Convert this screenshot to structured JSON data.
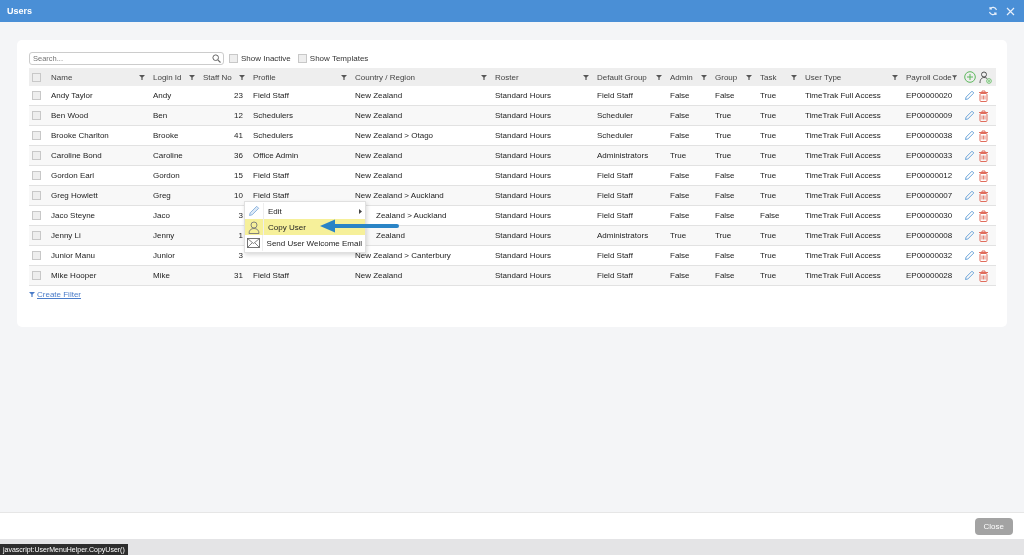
{
  "window": {
    "title": "Users"
  },
  "search": {
    "placeholder": "Search..."
  },
  "toggles": [
    {
      "label": "Show Inactive",
      "checked": false
    },
    {
      "label": "Show Templates",
      "checked": false
    }
  ],
  "table": {
    "select_all_checked": false,
    "columns": [
      "Name",
      "Login Id",
      "Staff No",
      "Profile",
      "Country / Region",
      "Roster",
      "Default Group",
      "Admin",
      "Group",
      "Task",
      "User Type",
      "Payroll Code"
    ],
    "rows": [
      {
        "checked": false,
        "cells": [
          "Andy Taylor",
          "Andy",
          "23",
          "Field Staff",
          "New Zealand",
          "Standard Hours",
          "Field Staff",
          "False",
          "False",
          "True",
          "TimeTrak Full Access",
          "EP00000020"
        ]
      },
      {
        "checked": false,
        "cells": [
          "Ben Wood",
          "Ben",
          "12",
          "Schedulers",
          "New Zealand",
          "Standard Hours",
          "Scheduler",
          "False",
          "True",
          "True",
          "TimeTrak Full Access",
          "EP00000009"
        ]
      },
      {
        "checked": false,
        "cells": [
          "Brooke Charlton",
          "Brooke",
          "41",
          "Schedulers",
          "New Zealand > Otago",
          "Standard Hours",
          "Scheduler",
          "False",
          "True",
          "True",
          "TimeTrak Full Access",
          "EP00000038"
        ]
      },
      {
        "checked": false,
        "cells": [
          "Caroline Bond",
          "Caroline",
          "36",
          "Office Admin",
          "New Zealand",
          "Standard Hours",
          "Administrators",
          "True",
          "True",
          "True",
          "TimeTrak Full Access",
          "EP00000033"
        ]
      },
      {
        "checked": false,
        "cells": [
          "Gordon Earl",
          "Gordon",
          "15",
          "Field Staff",
          "New Zealand",
          "Standard Hours",
          "Field Staff",
          "False",
          "False",
          "True",
          "TimeTrak Full Access",
          "EP00000012"
        ]
      },
      {
        "checked": false,
        "cells": [
          "Greg Howlett",
          "Greg",
          "10",
          "Field Staff",
          "New Zealand > Auckland",
          "Standard Hours",
          "Field Staff",
          "False",
          "False",
          "True",
          "TimeTrak Full Access",
          "EP00000007"
        ]
      },
      {
        "checked": false,
        "covered": true,
        "cells": [
          "Jaco Steyne",
          "Jaco",
          "3",
          null,
          "Zealand > Auckland",
          "Standard Hours",
          "Field Staff",
          "False",
          "False",
          "False",
          "TimeTrak Full Access",
          "EP00000030"
        ]
      },
      {
        "checked": false,
        "covered": true,
        "cells": [
          "Jenny Li",
          "Jenny",
          "1",
          null,
          "Zealand",
          "Standard Hours",
          "Administrators",
          "True",
          "True",
          "True",
          "TimeTrak Full Access",
          "EP00000008"
        ]
      },
      {
        "checked": false,
        "cells": [
          "Junior Manu",
          "Junior",
          "3",
          null,
          "New Zealand > Canterbury",
          "Standard Hours",
          "Field Staff",
          "False",
          "False",
          "True",
          "TimeTrak Full Access",
          "EP00000032"
        ]
      },
      {
        "checked": false,
        "cells": [
          "Mike Hooper",
          "Mike",
          "31",
          "Field Staff",
          "New Zealand",
          "Standard Hours",
          "Field Staff",
          "False",
          "False",
          "True",
          "TimeTrak Full Access",
          "EP00000028"
        ]
      }
    ]
  },
  "create_filter": "Create Filter",
  "context_menu": [
    {
      "kind": "pencil",
      "label": "Edit",
      "has_submenu": true,
      "selected": false
    },
    {
      "kind": "person",
      "label": "Copy User",
      "has_submenu": false,
      "selected": true
    },
    {
      "kind": "envelope",
      "label": "Send User Welcome Email",
      "has_submenu": false,
      "selected": false
    }
  ],
  "footer": {
    "button": "Close"
  },
  "status_bar": "javascript:UserMenuHelper.CopyUser()"
}
